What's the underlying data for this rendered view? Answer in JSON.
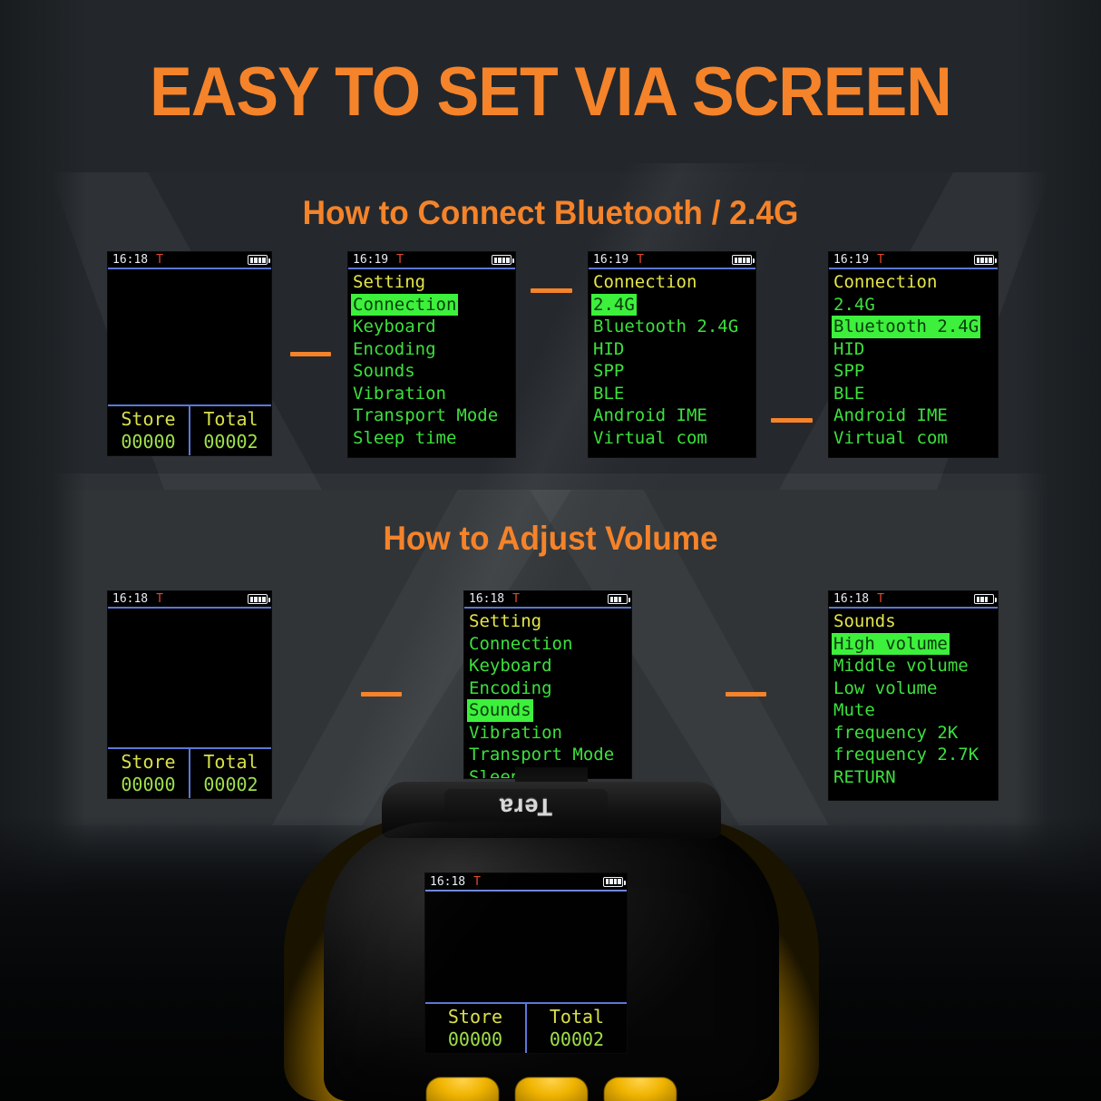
{
  "page": {
    "title": "EASY TO SET VIA SCREEN",
    "accent_color": "#F5832A",
    "background_color": "#23272b"
  },
  "sections": [
    {
      "id": "connect",
      "title": "How to Connect Bluetooth / 2.4G"
    },
    {
      "id": "volume",
      "title": "How to Adjust Volume"
    }
  ],
  "screens": {
    "home_1": {
      "time": "16:18",
      "mode_flag": "T",
      "battery_level": "4",
      "store_label": "Store",
      "store_value": "00000",
      "total_label": "Total",
      "total_value": "00002"
    },
    "setting_menu": {
      "time": "16:19",
      "mode_flag": "T",
      "battery_level": "4",
      "items": [
        {
          "label": "Setting",
          "style": "title"
        },
        {
          "label": "Connection",
          "style": "selected"
        },
        {
          "label": "Keyboard",
          "style": "normal"
        },
        {
          "label": "Encoding",
          "style": "normal"
        },
        {
          "label": "Sounds",
          "style": "normal"
        },
        {
          "label": "Vibration",
          "style": "normal"
        },
        {
          "label": "Transport Mode",
          "style": "normal"
        },
        {
          "label": "Sleep time",
          "style": "normal"
        }
      ]
    },
    "connection_24g": {
      "time": "16:19",
      "mode_flag": "T",
      "battery_level": "4",
      "items": [
        {
          "label": "Connection",
          "style": "title"
        },
        {
          "label": "2.4G",
          "style": "selected"
        },
        {
          "label": "Bluetooth 2.4G",
          "style": "normal"
        },
        {
          "label": "HID",
          "style": "normal"
        },
        {
          "label": "SPP",
          "style": "normal"
        },
        {
          "label": "BLE",
          "style": "normal"
        },
        {
          "label": "Android IME",
          "style": "normal"
        },
        {
          "label": "Virtual com",
          "style": "normal"
        }
      ]
    },
    "connection_bt": {
      "time": "16:19",
      "mode_flag": "T",
      "battery_level": "4",
      "items": [
        {
          "label": "Connection",
          "style": "title"
        },
        {
          "label": "2.4G",
          "style": "normal"
        },
        {
          "label": "Bluetooth 2.4G",
          "style": "selected"
        },
        {
          "label": "HID",
          "style": "normal"
        },
        {
          "label": "SPP",
          "style": "normal"
        },
        {
          "label": "BLE",
          "style": "normal"
        },
        {
          "label": "Android IME",
          "style": "normal"
        },
        {
          "label": "Virtual com",
          "style": "normal"
        }
      ]
    },
    "home_2": {
      "time": "16:18",
      "mode_flag": "T",
      "battery_level": "4",
      "store_label": "Store",
      "store_value": "00000",
      "total_label": "Total",
      "total_value": "00002"
    },
    "setting_menu_sounds": {
      "time": "16:18",
      "mode_flag": "T",
      "battery_level": "3",
      "items": [
        {
          "label": "Setting",
          "style": "title"
        },
        {
          "label": "Connection",
          "style": "normal"
        },
        {
          "label": "Keyboard",
          "style": "normal"
        },
        {
          "label": "Encoding",
          "style": "normal"
        },
        {
          "label": "Sounds",
          "style": "selected"
        },
        {
          "label": "Vibration",
          "style": "normal"
        },
        {
          "label": "Transport Mode",
          "style": "normal"
        },
        {
          "label": "Sleep time",
          "style": "normal"
        }
      ]
    },
    "sounds_menu": {
      "time": "16:18",
      "mode_flag": "T",
      "battery_level": "3",
      "items": [
        {
          "label": "Sounds",
          "style": "title"
        },
        {
          "label": "High volume",
          "style": "selected"
        },
        {
          "label": "Middle volume",
          "style": "normal"
        },
        {
          "label": "Low volume",
          "style": "normal"
        },
        {
          "label": "Mute",
          "style": "normal"
        },
        {
          "label": "frequency 2K",
          "style": "normal"
        },
        {
          "label": "frequency 2.7K",
          "style": "normal"
        },
        {
          "label": "RETURN",
          "style": "normal"
        }
      ]
    },
    "device_screen": {
      "time": "16:18",
      "mode_flag": "T",
      "battery_level": "4",
      "store_label": "Store",
      "store_value": "00000",
      "total_label": "Total",
      "total_value": "00002"
    }
  },
  "device": {
    "brand": "Tera",
    "body_color": "#101010",
    "accent_color": "#efb200"
  }
}
